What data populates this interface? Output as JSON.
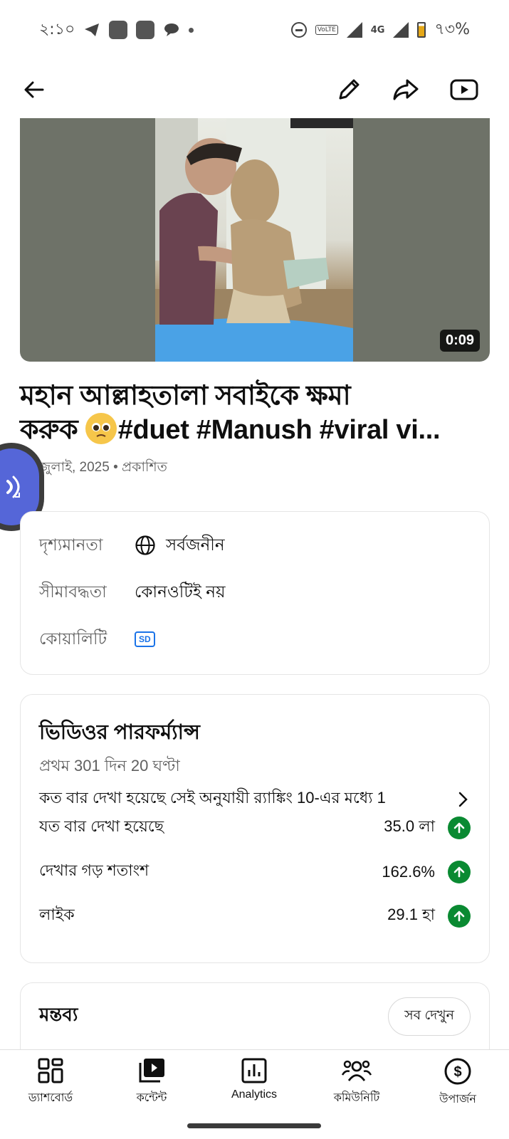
{
  "status_bar": {
    "time": "২:১০",
    "battery": "৭৩%",
    "network": "4G",
    "volte": "VoLTE"
  },
  "app_bar": {
    "back_icon": "arrow-left-icon",
    "edit_icon": "pencil-icon",
    "share_icon": "share-icon",
    "youtube_icon": "youtube-play-icon"
  },
  "video": {
    "duration": "0:09",
    "title": "মহান আল্লাহতালা সবাইকে ক্ষমা করুক 🥹#duet #Manush #viral vi...",
    "title_line1": "মহান আল্লাহতালা সবাইকে ক্ষমা",
    "title_line2_prefix": "করুক",
    "title_line2_suffix": "#duet #Manush #viral vi...",
    "meta": "20 জুলাই, 2025 • প্রকাশিত"
  },
  "info_card": {
    "rows": [
      {
        "label": "দৃশ্যমানতা",
        "value": "সর্বজনীন",
        "icon": "globe-icon"
      },
      {
        "label": "সীমাবদ্ধতা",
        "value": "কোনওটিই নয়"
      },
      {
        "label": "কোয়ালিটি",
        "value": "SD",
        "icon": "sd-badge"
      }
    ]
  },
  "performance": {
    "title": "ভিডিওর পারফর্ম্যান্স",
    "subtitle": "প্রথম 301 দিন 20 ঘণ্টা",
    "ranking": "কত বার দেখা হয়েছে সেই অনুযায়ী র‍্যাঙ্কিং 10-এর মধ্যে 1",
    "stats": [
      {
        "label": "যত বার দেখা হয়েছে",
        "value": "35.0 লা",
        "trend": "up"
      },
      {
        "label": "দেখার গড় শতাংশ",
        "value": "162.6%",
        "trend": "up"
      },
      {
        "label": "লাইক",
        "value": "29.1 হা",
        "trend": "up"
      }
    ],
    "trend_color": "#0a8a32"
  },
  "comments": {
    "title": "মন্তব্য",
    "see_all": "সব দেখুন"
  },
  "bottom_nav": [
    {
      "label": "ড্যাশবোর্ড",
      "icon": "dashboard-icon"
    },
    {
      "label": "কন্টেন্ট",
      "icon": "content-icon"
    },
    {
      "label": "Analytics",
      "icon": "analytics-icon"
    },
    {
      "label": "কমিউনিটি",
      "icon": "community-icon"
    },
    {
      "label": "উপার্জন",
      "icon": "earn-icon"
    }
  ]
}
